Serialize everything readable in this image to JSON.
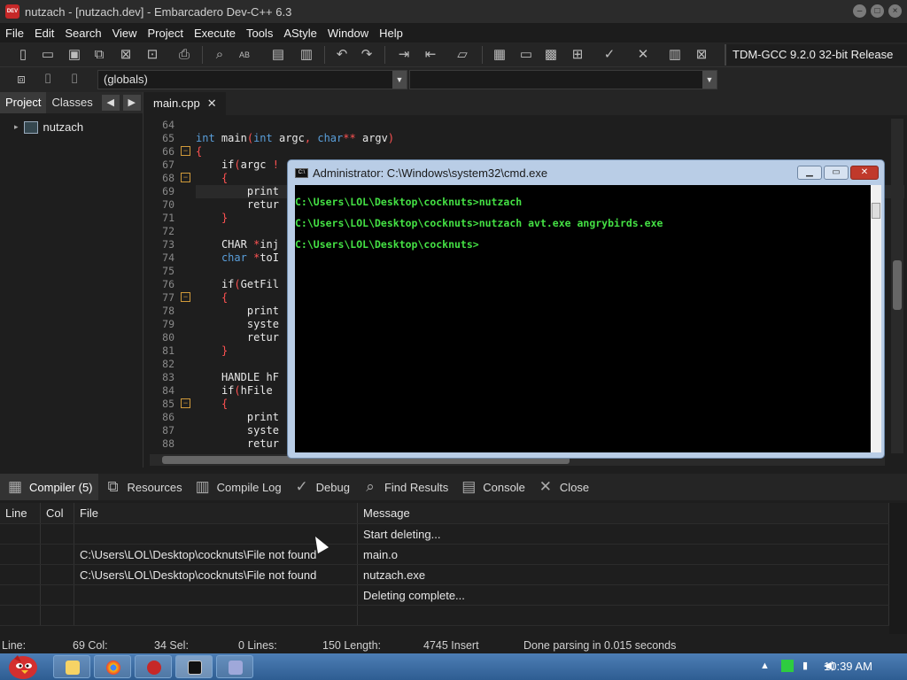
{
  "window": {
    "title": "nutzach - [nutzach.dev] - Embarcadero Dev-C++ 6.3",
    "icon": "devcpp-icon",
    "icon_text": "DEV"
  },
  "menu": [
    "File",
    "Edit",
    "Search",
    "View",
    "Project",
    "Execute",
    "Tools",
    "AStyle",
    "Window",
    "Help"
  ],
  "toolbar": {
    "compiler": "TDM-GCC 9.2.0 32-bit Release",
    "scope": "(globals)"
  },
  "left_panel": {
    "tabs": [
      "Project",
      "Classes"
    ],
    "active_tab": "Project",
    "project_name": "nutzach"
  },
  "editor": {
    "tab_label": "main.cpp",
    "line_numbers": [
      "64",
      "65",
      "66",
      "67",
      "68",
      "69",
      "70",
      "71",
      "72",
      "73",
      "74",
      "75",
      "76",
      "77",
      "78",
      "79",
      "80",
      "81",
      "82",
      "83",
      "84",
      "85",
      "86",
      "87",
      "88"
    ],
    "lines": [
      "",
      "int main(int argc, char** argv)",
      "{",
      "    if(argc !",
      "    {",
      "        print",
      "        retur",
      "    }",
      "",
      "    CHAR *inj",
      "    char *toI",
      "",
      "    if(GetFil",
      "    {",
      "        print",
      "        syste",
      "        retur",
      "    }",
      "",
      "    HANDLE hF",
      "    if(hFile ",
      "    {",
      "        print",
      "        syste",
      "        retur"
    ]
  },
  "cmd": {
    "title": "Administrator: C:\\Windows\\system32\\cmd.exe",
    "icon_text": "C:\\",
    "lines": [
      "C:\\Users\\LOL\\Desktop\\cocknuts>nutzach",
      "C:\\Users\\LOL\\Desktop\\cocknuts>nutzach avt.exe angrybirds.exe",
      "C:\\Users\\LOL\\Desktop\\cocknuts>"
    ]
  },
  "bottom_tabs": [
    {
      "label": "Compiler (5)",
      "icon": "compiler-icon"
    },
    {
      "label": "Resources",
      "icon": "resources-icon"
    },
    {
      "label": "Compile Log",
      "icon": "compile-log-icon"
    },
    {
      "label": "Debug",
      "icon": "debug-icon"
    },
    {
      "label": "Find Results",
      "icon": "find-results-icon"
    },
    {
      "label": "Console",
      "icon": "console-icon"
    },
    {
      "label": "Close",
      "icon": "close-icon"
    }
  ],
  "messages": {
    "headers": [
      "Line",
      "Col",
      "File",
      "Message"
    ],
    "rows": [
      {
        "line": "",
        "col": "",
        "file": "",
        "message": "Start deleting..."
      },
      {
        "line": "",
        "col": "",
        "file": "C:\\Users\\LOL\\Desktop\\cocknuts\\File not found",
        "message": "main.o"
      },
      {
        "line": "",
        "col": "",
        "file": "C:\\Users\\LOL\\Desktop\\cocknuts\\File not found",
        "message": "nutzach.exe"
      },
      {
        "line": "",
        "col": "",
        "file": "",
        "message": "Deleting complete..."
      },
      {
        "line": "",
        "col": "",
        "file": "",
        "message": ""
      }
    ]
  },
  "status": {
    "line": "Line:",
    "line_val": "69 Col:",
    "col_val": "34 Sel:",
    "sel_val": "0 Lines:",
    "lines_val": "150 Length:",
    "length_val": "4745 Insert",
    "parse": "Done parsing in 0.015 seconds"
  },
  "taskbar": {
    "clock": "10:39 AM",
    "items": [
      "explorer",
      "chrome",
      "devcpp",
      "cmd",
      "app"
    ]
  }
}
